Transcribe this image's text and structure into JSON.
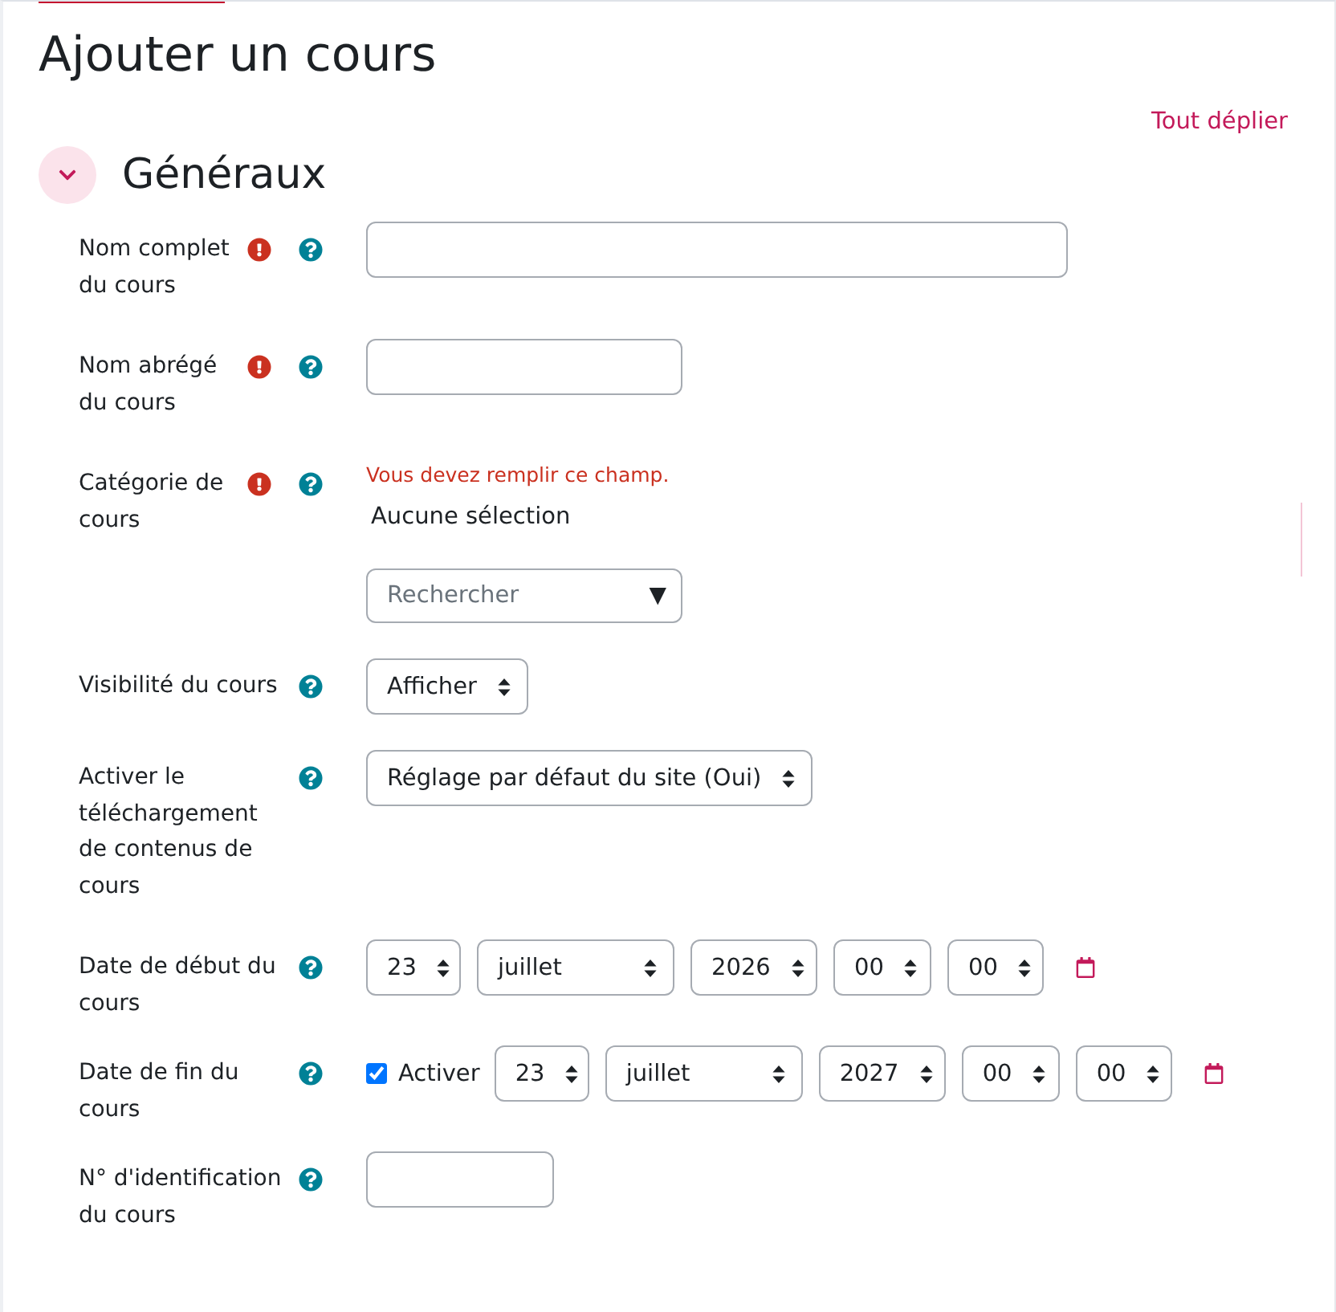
{
  "page": {
    "title": "Ajouter un cours",
    "expand_all_link": "Tout déplier"
  },
  "section": {
    "title": "Généraux",
    "expanded": true
  },
  "fields": [
    {
      "kind": "text",
      "label": "Nom complet du cours",
      "required": true
    },
    {
      "kind": "text",
      "label": "Nom abrégé du cours",
      "required": true
    },
    {
      "kind": "autocomplete",
      "label": "Catégorie de cours",
      "required": true,
      "error": "Vous devez remplir ce champ.",
      "selection": "Aucune sélection",
      "search": {
        "placeholder": "Rechercher",
        "toggle": "▼"
      }
    },
    {
      "kind": "select",
      "label": "Visibilité du cours",
      "required": false,
      "value": "Afficher"
    },
    {
      "kind": "select",
      "label": "Activer le téléchargement de contenus de cours",
      "required": false,
      "value": "Réglage par défaut du site (Oui)"
    },
    {
      "kind": "date",
      "label": "Date de début du cours",
      "required": false,
      "parts": [
        {
          "kind": "day",
          "value": "23"
        },
        {
          "kind": "month",
          "value": "juillet"
        },
        {
          "kind": "year",
          "value": "2026"
        },
        {
          "kind": "hour",
          "value": "00"
        },
        {
          "kind": "minute",
          "value": "00"
        }
      ]
    },
    {
      "kind": "date",
      "label": "Date de fin du cours",
      "required": false,
      "enable": {
        "label": "Activer",
        "checked": true
      },
      "parts": [
        {
          "kind": "day",
          "value": "23"
        },
        {
          "kind": "month",
          "value": "juillet"
        },
        {
          "kind": "year",
          "value": "2027"
        },
        {
          "kind": "hour",
          "value": "00"
        },
        {
          "kind": "minute",
          "value": "00"
        }
      ]
    },
    {
      "kind": "text",
      "label": "N° d'identification du cours",
      "required": false
    }
  ]
}
